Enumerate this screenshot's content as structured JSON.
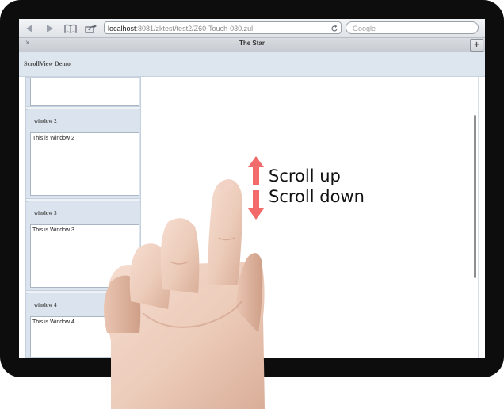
{
  "browser": {
    "back_icon": "back-arrow-icon",
    "forward_icon": "forward-arrow-icon",
    "bookmarks_icon": "book-icon",
    "share_icon": "share-icon",
    "url_host": "localhost",
    "url_path": ":8081/zktest/test2/Z60-Touch-030.zul",
    "reload_icon": "reload-icon",
    "search_placeholder": "Google",
    "tab_close": "×",
    "tab_title": "The Star",
    "new_tab": "+"
  },
  "page": {
    "header_title": "ScrollView Demo",
    "windows": [
      {
        "title": "window 2",
        "body": "This is Window 2"
      },
      {
        "title": "window 3",
        "body": "This is Window 3"
      },
      {
        "title": "window 4",
        "body": "This is Window 4"
      }
    ]
  },
  "annotation": {
    "scroll_up": "Scroll up",
    "scroll_down": "Scroll down",
    "arrow_color": "#f26a6a"
  }
}
